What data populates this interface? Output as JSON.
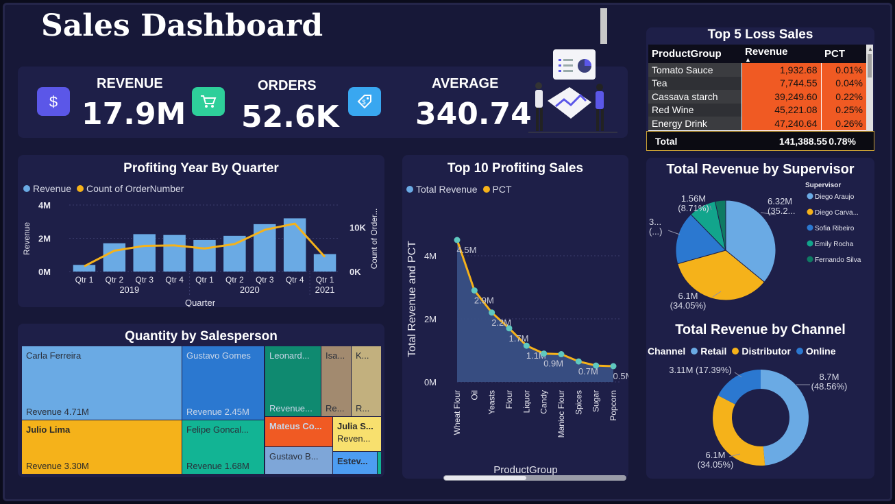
{
  "header": {
    "title": "Sales Dashboard"
  },
  "kpis": [
    {
      "label": "REVENUE",
      "value": "17.9M",
      "icon": "dollar-icon",
      "color": "#5b57e8"
    },
    {
      "label": "ORDERS",
      "value": "52.6K",
      "icon": "cart-icon",
      "color": "#2ecf9a"
    },
    {
      "label": "AVERAGE",
      "value": "340.74",
      "icon": "tag-icon",
      "color": "#39a7f0"
    }
  ],
  "loss_table": {
    "title": "Top 5 Loss Sales",
    "headers": [
      "ProductGroup",
      "Revenue",
      "PCT"
    ],
    "rows": [
      [
        "Tomato Sauce",
        "1,932.68",
        "0.01%"
      ],
      [
        "Tea",
        "7,744.55",
        "0.04%"
      ],
      [
        "Cassava starch",
        "39,249.60",
        "0.22%"
      ],
      [
        "Red Wine",
        "45,221.08",
        "0.25%"
      ],
      [
        "Energy Drink",
        "47,240.64",
        "0.26%"
      ]
    ],
    "total": [
      "Total",
      "141,388.55",
      "0.78%"
    ]
  },
  "colors": {
    "blue": "#6aaae4",
    "yellow": "#f5b21a",
    "orange": "#f05a23",
    "card": "#1e1f48"
  },
  "chart_data": [
    {
      "type": "bar",
      "title": "Profiting Year By Quarter",
      "xlabel": "Quarter",
      "ylabel": "Revenue",
      "y2label": "Count of Order...",
      "legend": [
        "Revenue",
        "Count of OrderNumber"
      ],
      "categories": [
        "Qtr 1",
        "Qtr 2",
        "Qtr 3",
        "Qtr 4",
        "Qtr 1",
        "Qtr 2",
        "Qtr 3",
        "Qtr 4",
        "Qtr 1"
      ],
      "years": [
        [
          "2019",
          0,
          3
        ],
        [
          "2020",
          4,
          7
        ],
        [
          "2021",
          8,
          8
        ]
      ],
      "series": [
        {
          "name": "Revenue",
          "axis": "left",
          "values": [
            0.4,
            1.7,
            2.25,
            2.2,
            1.9,
            2.15,
            2.85,
            3.2,
            1.05
          ]
        },
        {
          "name": "Count of OrderNumber",
          "axis": "right",
          "values": [
            1200,
            4700,
            5800,
            5900,
            5200,
            6200,
            9400,
            10800,
            3300
          ]
        }
      ],
      "ylim": [
        0,
        4
      ],
      "y2lim": [
        0,
        15000
      ],
      "yticks": [
        "0M",
        "2M",
        "4M"
      ],
      "y2ticks": [
        "0K",
        "10K"
      ]
    },
    {
      "type": "area",
      "title": "Top 10 Profiting Sales",
      "xlabel": "ProductGroup",
      "ylabel": "Total Revenue and PCT",
      "legend": [
        "Total Revenue",
        "PCT"
      ],
      "categories": [
        "Wheat Flour",
        "Oil",
        "Yeasts",
        "Flour",
        "Liquor",
        "Candy",
        "Manioc Flour",
        "Spices",
        "Sugar",
        "Popcorn"
      ],
      "values": [
        4.5,
        2.9,
        2.2,
        1.7,
        1.15,
        0.9,
        0.88,
        0.65,
        0.52,
        0.5
      ],
      "data_labels": [
        "4.5M",
        "2.9M",
        "2.2M",
        "1.7M",
        "1.1M",
        "0.9M",
        "",
        "0.7M",
        "",
        "0.5M"
      ],
      "ylim": [
        0,
        5
      ],
      "yticks": [
        "0M",
        "2M",
        "4M"
      ]
    },
    {
      "type": "pie",
      "title": "Total Revenue by Supervisor",
      "legend_title": "Supervisor",
      "labels": [
        "Diego Araujo",
        "Diego Carva...",
        "Sofia Ribeiro",
        "Emily Rocha",
        "Fernando Silva"
      ],
      "values": [
        6.32,
        6.1,
        3.0,
        1.56,
        0.6
      ],
      "colors": [
        "#6aaae4",
        "#f5b21a",
        "#2b78d0",
        "#12a58c",
        "#0f7a63"
      ],
      "data_labels": [
        "6.32M\n(35.2...",
        "6.1M\n(34.05%)",
        "3...\n(...)",
        "1.56M\n(8.71%)"
      ]
    },
    {
      "type": "pie",
      "title": "Total Revenue by Channel",
      "legend_title": "Channel",
      "labels": [
        "Retail",
        "Distributor",
        "Online"
      ],
      "values": [
        8.7,
        6.1,
        3.11
      ],
      "colors": [
        "#6aaae4",
        "#f5b21a",
        "#2b78d0"
      ],
      "data_labels": [
        "8.7M\n(48.56%)",
        "6.1M\n(34.05%)",
        "3.11M (17.39%)"
      ]
    },
    {
      "type": "treemap",
      "title": "Quantity by Salesperson",
      "items": [
        {
          "name": "Carla Ferreira",
          "value": "Revenue 4.71M",
          "color": "#6aaae4"
        },
        {
          "name": "Julio Lima",
          "value": "Revenue 3.30M",
          "color": "#f5b21a"
        },
        {
          "name": "Gustavo Gomes",
          "value": "Revenue 2.45M",
          "color": "#2b78d0"
        },
        {
          "name": "Felipe Goncal...",
          "value": "Revenue 1.68M",
          "color": "#12b494"
        },
        {
          "name": "Leonard...",
          "value": "Revenue...",
          "color": "#0f8a70"
        },
        {
          "name": "Isa...",
          "value": "Re...",
          "color": "#a28a6f"
        },
        {
          "name": "K...",
          "value": "R...",
          "color": "#c2b07e"
        },
        {
          "name": "Mateus Co...",
          "value": "",
          "color": "#f05a23"
        },
        {
          "name": "Julia S...",
          "value": "Reven...",
          "color": "#f8e06e"
        },
        {
          "name": "Gustavo B...",
          "value": "",
          "color": "#7ea6d8"
        },
        {
          "name": "Estev...",
          "value": "",
          "color": "#4d9df2"
        }
      ]
    }
  ]
}
